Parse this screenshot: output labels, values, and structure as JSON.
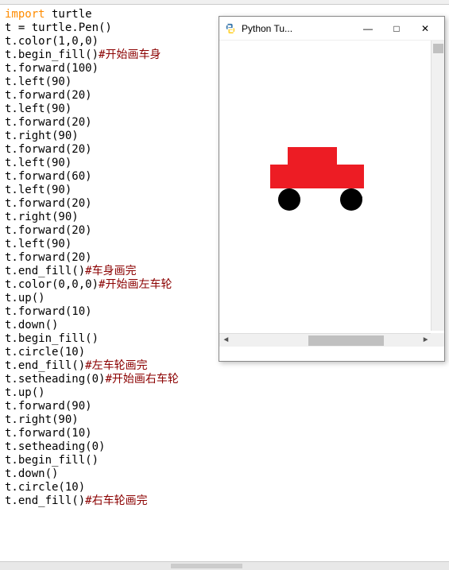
{
  "code": {
    "lines": [
      {
        "segments": [
          {
            "t": "import",
            "c": "kw"
          },
          {
            "t": " turtle",
            "c": "txt"
          }
        ]
      },
      {
        "segments": [
          {
            "t": "t = turtle.Pen()",
            "c": "txt"
          }
        ]
      },
      {
        "segments": [
          {
            "t": "t.color(1,0,0)",
            "c": "txt"
          }
        ]
      },
      {
        "segments": [
          {
            "t": "",
            "c": "txt"
          }
        ]
      },
      {
        "segments": [
          {
            "t": "t.begin_fill()",
            "c": "txt"
          },
          {
            "t": "#开始画车身",
            "c": "cmt"
          }
        ]
      },
      {
        "segments": [
          {
            "t": "t.forward(100)",
            "c": "txt"
          }
        ]
      },
      {
        "segments": [
          {
            "t": "t.left(90)",
            "c": "txt"
          }
        ]
      },
      {
        "segments": [
          {
            "t": "t.forward(20)",
            "c": "txt"
          }
        ]
      },
      {
        "segments": [
          {
            "t": "t.left(90)",
            "c": "txt"
          }
        ]
      },
      {
        "segments": [
          {
            "t": "t.forward(20)",
            "c": "txt"
          }
        ]
      },
      {
        "segments": [
          {
            "t": "t.right(90)",
            "c": "txt"
          }
        ]
      },
      {
        "segments": [
          {
            "t": "t.forward(20)",
            "c": "txt"
          }
        ]
      },
      {
        "segments": [
          {
            "t": "t.left(90)",
            "c": "txt"
          }
        ]
      },
      {
        "segments": [
          {
            "t": "t.forward(60)",
            "c": "txt"
          }
        ]
      },
      {
        "segments": [
          {
            "t": "t.left(90)",
            "c": "txt"
          }
        ]
      },
      {
        "segments": [
          {
            "t": "t.forward(20)",
            "c": "txt"
          }
        ]
      },
      {
        "segments": [
          {
            "t": "t.right(90)",
            "c": "txt"
          }
        ]
      },
      {
        "segments": [
          {
            "t": "t.forward(20)",
            "c": "txt"
          }
        ]
      },
      {
        "segments": [
          {
            "t": "t.left(90)",
            "c": "txt"
          }
        ]
      },
      {
        "segments": [
          {
            "t": "t.forward(20)",
            "c": "txt"
          }
        ]
      },
      {
        "segments": [
          {
            "t": "t.end_fill()",
            "c": "txt"
          },
          {
            "t": "#车身画完",
            "c": "cmt"
          }
        ]
      },
      {
        "segments": [
          {
            "t": "",
            "c": "txt"
          }
        ]
      },
      {
        "segments": [
          {
            "t": "t.color(0,0,0)",
            "c": "txt"
          },
          {
            "t": "#开始画左车轮",
            "c": "cmt"
          }
        ]
      },
      {
        "segments": [
          {
            "t": "t.up()",
            "c": "txt"
          }
        ]
      },
      {
        "segments": [
          {
            "t": "t.forward(10)",
            "c": "txt"
          }
        ]
      },
      {
        "segments": [
          {
            "t": "t.down()",
            "c": "txt"
          }
        ]
      },
      {
        "segments": [
          {
            "t": "t.begin_fill()",
            "c": "txt"
          }
        ]
      },
      {
        "segments": [
          {
            "t": "t.circle(10)",
            "c": "txt"
          }
        ]
      },
      {
        "segments": [
          {
            "t": "t.end_fill()",
            "c": "txt"
          },
          {
            "t": "#左车轮画完",
            "c": "cmt"
          }
        ]
      },
      {
        "segments": [
          {
            "t": "",
            "c": "txt"
          }
        ]
      },
      {
        "segments": [
          {
            "t": "t.setheading(0)",
            "c": "txt"
          },
          {
            "t": "#开始画右车轮",
            "c": "cmt"
          }
        ]
      },
      {
        "segments": [
          {
            "t": "t.up()",
            "c": "txt"
          }
        ]
      },
      {
        "segments": [
          {
            "t": "t.forward(90)",
            "c": "txt"
          }
        ]
      },
      {
        "segments": [
          {
            "t": "t.right(90)",
            "c": "txt"
          }
        ]
      },
      {
        "segments": [
          {
            "t": "t.forward(10)",
            "c": "txt"
          }
        ]
      },
      {
        "segments": [
          {
            "t": "t.setheading(0)",
            "c": "txt"
          }
        ]
      },
      {
        "segments": [
          {
            "t": "t.begin_fill()",
            "c": "txt"
          }
        ]
      },
      {
        "segments": [
          {
            "t": "t.down()",
            "c": "txt"
          }
        ]
      },
      {
        "segments": [
          {
            "t": "t.circle(10)",
            "c": "txt"
          }
        ]
      },
      {
        "segments": [
          {
            "t": "t.end_fill()",
            "c": "txt"
          },
          {
            "t": "#右车轮画完",
            "c": "cmt"
          }
        ]
      }
    ]
  },
  "turtle_window": {
    "title": "Python Tu...",
    "min_label": "—",
    "max_label": "□",
    "close_label": "✕"
  },
  "colors": {
    "car_red": "#ed1c24",
    "wheel_black": "#000000",
    "keyword_orange": "#ff8c00",
    "comment_darkred": "#8b0000"
  }
}
